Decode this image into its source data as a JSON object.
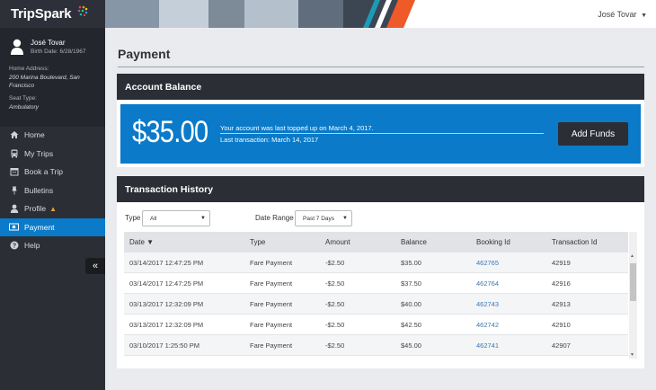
{
  "app": {
    "brand": "TripSpark"
  },
  "header": {
    "user_name": "José Tovar"
  },
  "profile": {
    "name": "José Tovar",
    "birth_date": "Birth Date: 6/28/1967",
    "home_address_label": "Home Address:",
    "home_address": "200 Marina Boulevard, San Francisco",
    "seat_type_label": "Seat Type:",
    "seat_type": "Ambulatory"
  },
  "sidebar": {
    "items": [
      {
        "label": "Home",
        "icon": "home-icon"
      },
      {
        "label": "My Trips",
        "icon": "bus-icon"
      },
      {
        "label": "Book a Trip",
        "icon": "calendar-icon"
      },
      {
        "label": "Bulletins",
        "icon": "pushpin-icon"
      },
      {
        "label": "Profile",
        "icon": "user-icon"
      },
      {
        "label": "Payment",
        "icon": "money-icon",
        "active": true
      },
      {
        "label": "Help",
        "icon": "help-icon"
      }
    ],
    "collapse_glyph": "«"
  },
  "page": {
    "title": "Payment"
  },
  "balance": {
    "title": "Account Balance",
    "amount": "$35.00",
    "last_topped": "Your account was last topped up on March 4, 2017.",
    "last_transaction": "Last transaction: March 14, 2017",
    "add_funds_label": "Add Funds"
  },
  "history": {
    "title": "Transaction History",
    "type_label": "Type",
    "type_value": "All",
    "date_range_label": "Date Range",
    "date_range_value": "Past 7 Days",
    "columns": [
      "Date ▼",
      "Type",
      "Amount",
      "Balance",
      "Booking Id",
      "Transaction Id"
    ],
    "rows": [
      {
        "date": "03/14/2017 12:47:25 PM",
        "type": "Fare Payment",
        "amount": "-$2.50",
        "balance": "$35.00",
        "booking": "462765",
        "txn": "42919"
      },
      {
        "date": "03/14/2017 12:47:25 PM",
        "type": "Fare Payment",
        "amount": "-$2.50",
        "balance": "$37.50",
        "booking": "462764",
        "txn": "42916"
      },
      {
        "date": "03/13/2017 12:32:09 PM",
        "type": "Fare Payment",
        "amount": "-$2.50",
        "balance": "$40.00",
        "booking": "462743",
        "txn": "42913"
      },
      {
        "date": "03/13/2017 12:32:09 PM",
        "type": "Fare Payment",
        "amount": "-$2.50",
        "balance": "$42.50",
        "booking": "462742",
        "txn": "42910"
      },
      {
        "date": "03/10/2017 1:25:50 PM",
        "type": "Fare Payment",
        "amount": "-$2.50",
        "balance": "$45.00",
        "booking": "462741",
        "txn": "42907"
      }
    ]
  },
  "colors": {
    "accent": "#0a7ac9",
    "dark": "#2b2e35",
    "warning": "#f0a030"
  }
}
